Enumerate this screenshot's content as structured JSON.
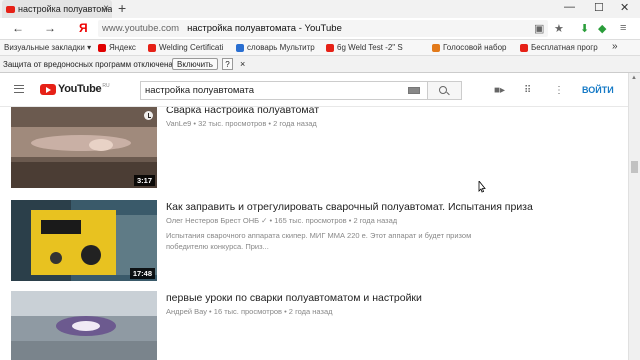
{
  "browser": {
    "tab_title": "настройка полуавтомата",
    "tab_close": "×",
    "new_tab": "+",
    "window_controls": [
      "—",
      "☐",
      "✕"
    ],
    "nav_back": "←",
    "nav_forward": "→",
    "yandex": "Я",
    "url_host": "www.youtube.com",
    "url_title": "настройка полуавтомата - YouTube",
    "bookmarks": [
      {
        "label": "Визуальные закладки ▾",
        "color": "#ffffff"
      },
      {
        "label": "Яндекс",
        "color": "#e00000"
      },
      {
        "label": "Welding Certificati",
        "color": "#e62117"
      },
      {
        "label": "словарь Мультитр",
        "color": "#2a6fd1"
      },
      {
        "label": "6g Weld Test -2\" S",
        "color": "#e62117"
      },
      {
        "label": "Голосовой набор",
        "color": "#e27a1b"
      },
      {
        "label": "Бесплатная прогр",
        "color": "#e62117"
      }
    ],
    "bookmarks_more": "»",
    "infobar_text": "Защита от вредоносных программ отключена",
    "infobar_button": "Включить",
    "infobar_help": "?",
    "infobar_close": "×"
  },
  "youtube": {
    "logo_text": "YouTube",
    "logo_region": "RU",
    "search_value": "настройка полуавтомата",
    "signin": "ВОЙТИ",
    "accent": "#e62117"
  },
  "results": [
    {
      "title": "Сварка настройка полуавтомат",
      "meta": "VanLe9 • 32 тыс. просмотров • 2 года назад",
      "description": "",
      "duration": "3:17"
    },
    {
      "title": "Как заправить и отрегулировать сварочный полуавтомат. Испытания приза",
      "meta": "Олег Нестеров Брест ОНБ  ✓ • 165 тыс. просмотров • 2 года назад",
      "description": "Испытания сварочного аппарата скипер. МИГ ММА 220 е. Этот аппарат и будет призом победителю конкурса. Приз...",
      "duration": "17:48"
    },
    {
      "title": "первые уроки по сварки полуавтоматом и настройки",
      "meta": "Андрей Вау • 16 тыс. просмотров • 2 года назад",
      "description": "",
      "duration": ""
    }
  ]
}
